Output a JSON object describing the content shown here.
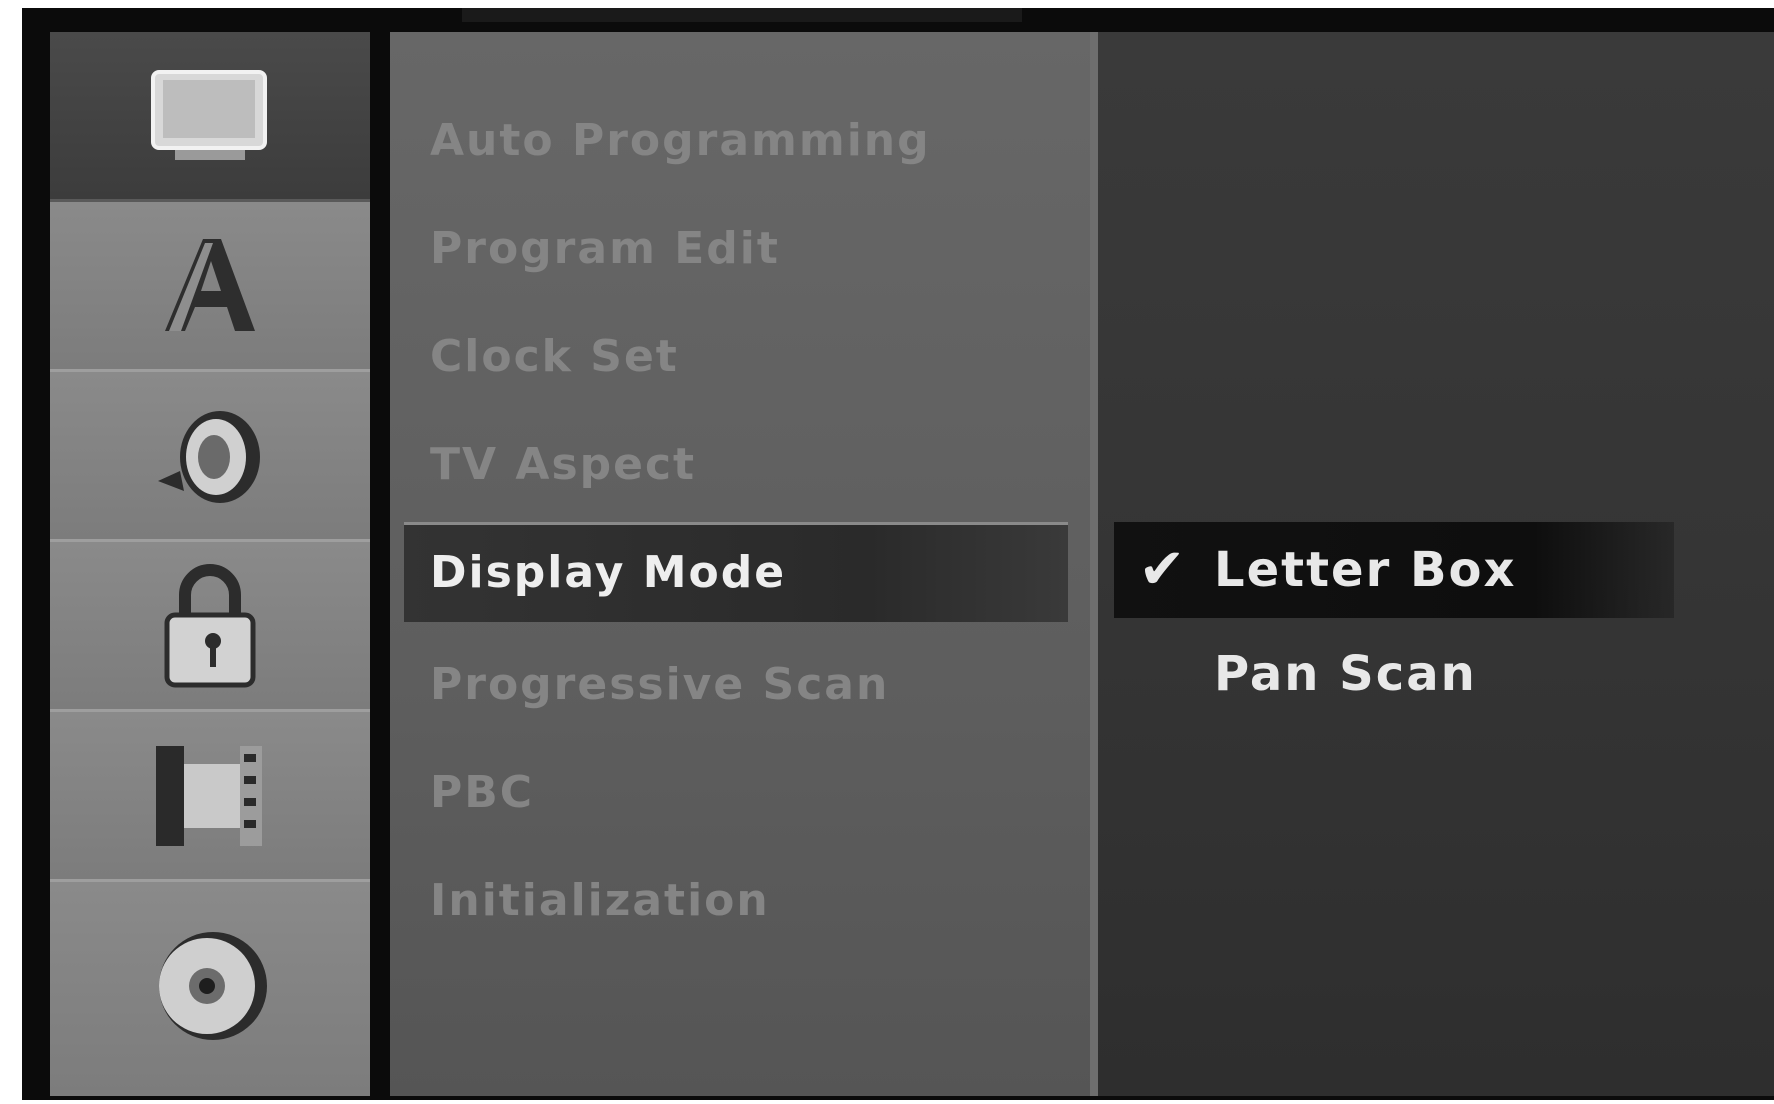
{
  "menu": {
    "items": [
      {
        "label": "Auto Programming"
      },
      {
        "label": "Program Edit"
      },
      {
        "label": "Clock Set"
      },
      {
        "label": "TV Aspect"
      },
      {
        "label": "Display Mode"
      },
      {
        "label": "Progressive Scan"
      },
      {
        "label": "PBC"
      },
      {
        "label": "Initialization"
      }
    ],
    "selected_index": 4
  },
  "options": {
    "items": [
      {
        "label": "Letter Box",
        "checked": true,
        "check_glyph": "✔"
      },
      {
        "label": "Pan Scan",
        "checked": false
      }
    ]
  },
  "sidebar": {
    "icons": [
      {
        "name": "tv-monitor-icon",
        "active": true
      },
      {
        "name": "language-a-icon",
        "active": false
      },
      {
        "name": "speaker-audio-icon",
        "active": false
      },
      {
        "name": "padlock-icon",
        "active": false
      },
      {
        "name": "film-recording-icon",
        "active": false
      },
      {
        "name": "disc-icon",
        "active": false
      }
    ]
  },
  "colors": {
    "selected_text": "#eeeeee",
    "dim_text": "#858585",
    "option_text": "#e8e8e8"
  }
}
